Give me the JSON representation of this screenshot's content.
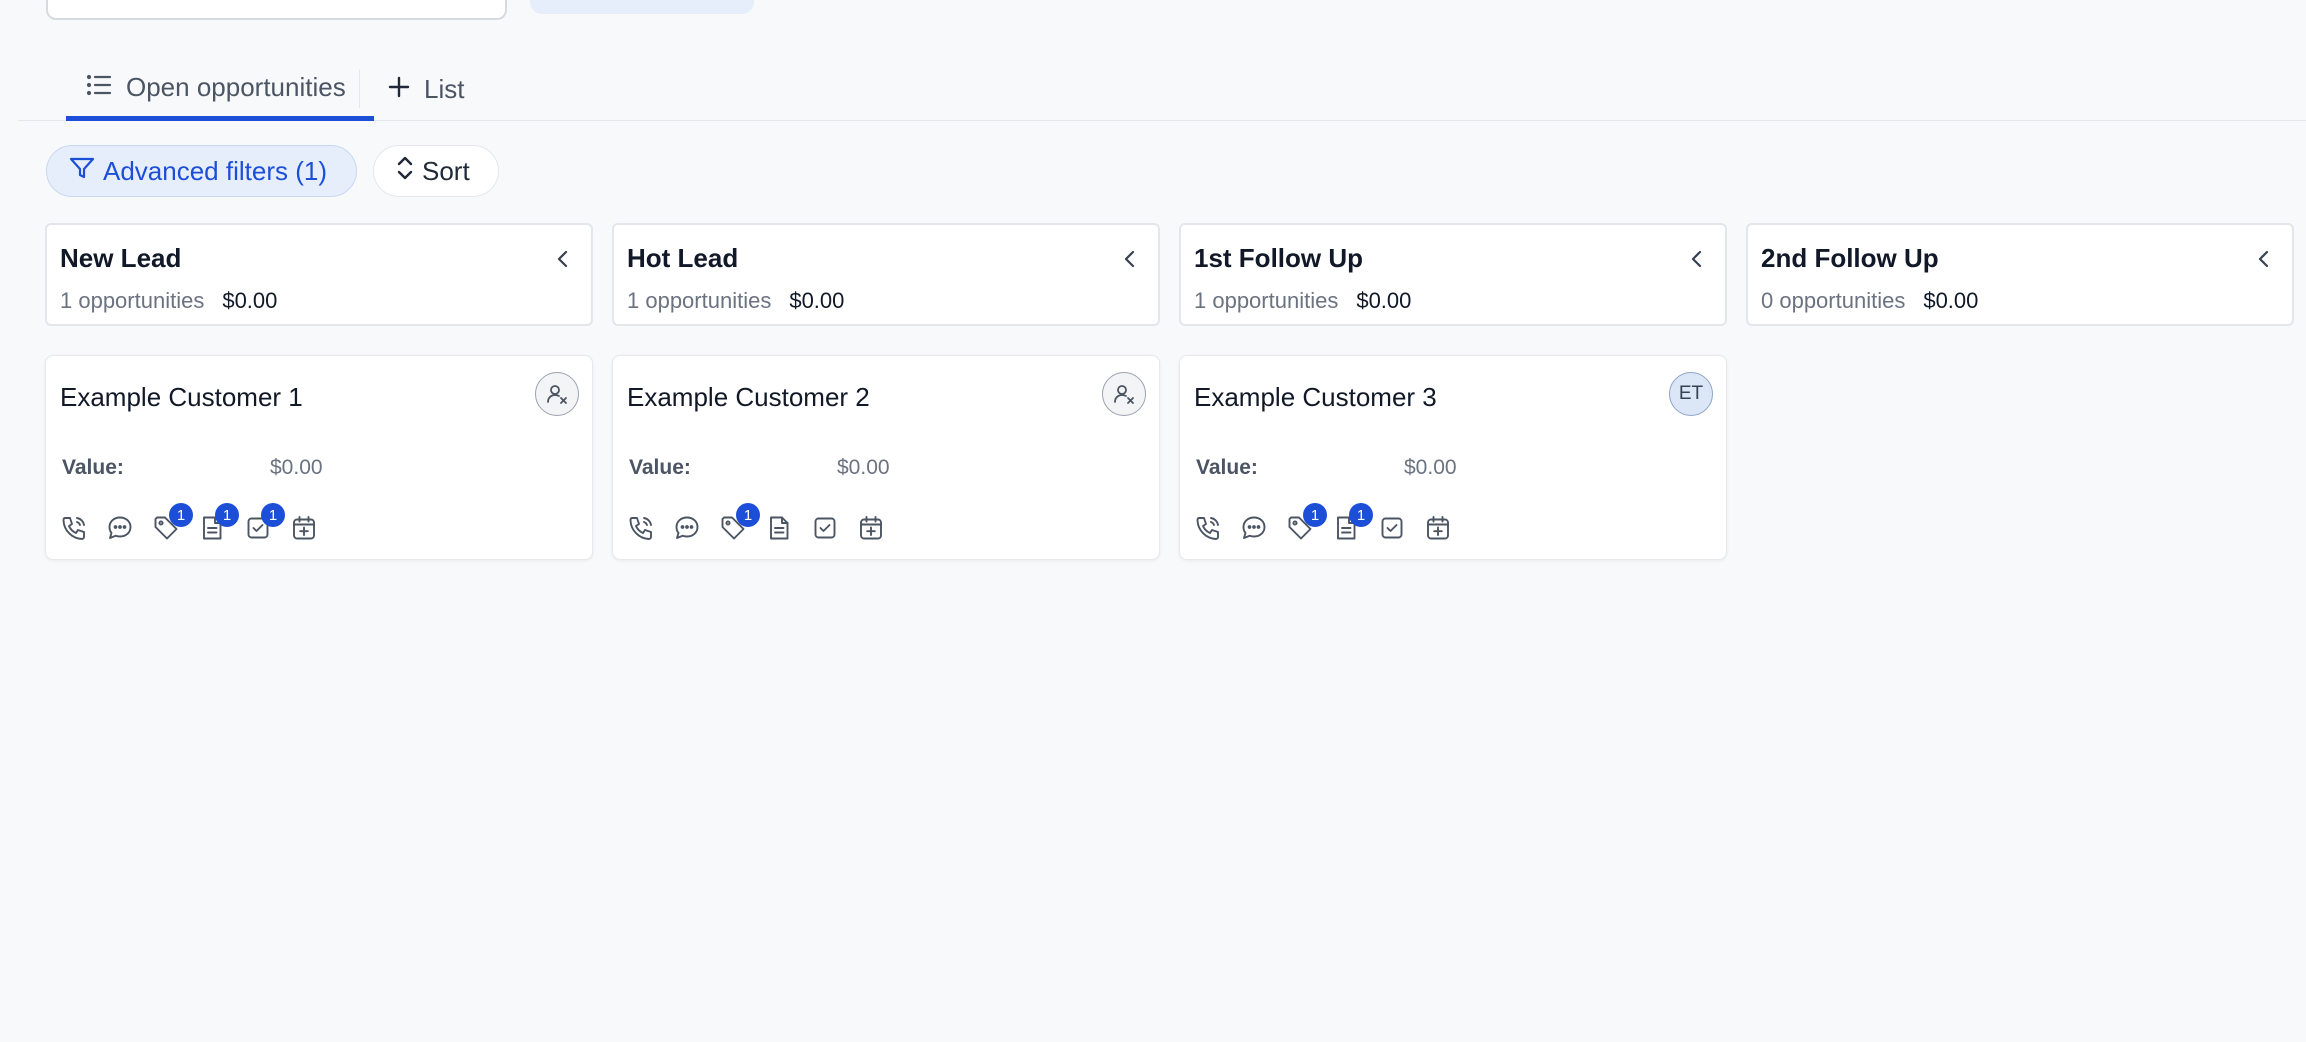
{
  "tabs": [
    {
      "label": "Open opportunities"
    },
    {
      "label": "List"
    }
  ],
  "toolbar": {
    "filter_label": "Advanced filters (1)",
    "sort_label": "Sort"
  },
  "columns": [
    {
      "title": "New Lead",
      "count": "1 opportunities",
      "value": "$0.00"
    },
    {
      "title": "Hot Lead",
      "count": "1 opportunities",
      "value": "$0.00"
    },
    {
      "title": "1st Follow Up",
      "count": "1 opportunities",
      "value": "$0.00"
    },
    {
      "title": "2nd Follow Up",
      "count": "0 opportunities",
      "value": "$0.00"
    }
  ],
  "cards": [
    {
      "name": "Example Customer 1",
      "avatar": "unassigned-icon",
      "avatar_text": "",
      "value_label": "Value:",
      "value": "$0.00",
      "badges": {
        "tag": "1",
        "note": "1",
        "task": "1"
      }
    },
    {
      "name": "Example Customer 2",
      "avatar": "unassigned-icon",
      "avatar_text": "",
      "value_label": "Value:",
      "value": "$0.00",
      "badges": {
        "tag": "1"
      }
    },
    {
      "name": "Example Customer 3",
      "avatar": "initials",
      "avatar_text": "ET",
      "value_label": "Value:",
      "value": "$0.00",
      "badges": {
        "tag": "1",
        "note": "1"
      }
    }
  ],
  "icons": [
    "list-icon",
    "plus-icon",
    "filter-icon",
    "sort-icon",
    "chevron-left-icon",
    "phone-icon",
    "chat-icon",
    "tag-icon",
    "note-icon",
    "task-icon",
    "calendar-add-icon"
  ],
  "colors": {
    "accent": "#1d4ed8",
    "background": "#f8f9fb"
  }
}
